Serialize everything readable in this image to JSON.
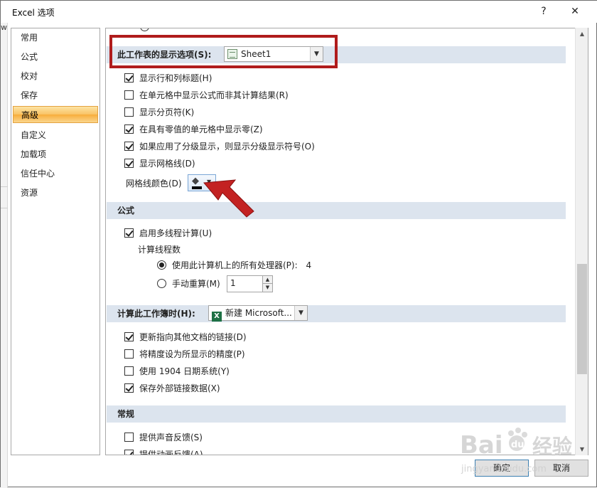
{
  "window": {
    "title": "Excel 选项",
    "help_label": "?",
    "close_label": "✕"
  },
  "left_strip": {
    "fragment": "w"
  },
  "nav": {
    "items": [
      {
        "label": "常用"
      },
      {
        "label": "公式"
      },
      {
        "label": "校对"
      },
      {
        "label": "保存"
      },
      {
        "label": "高级",
        "active": true
      },
      {
        "label": "自定义"
      },
      {
        "label": "加载项"
      },
      {
        "label": "信任中心"
      },
      {
        "label": "资源"
      }
    ]
  },
  "content": {
    "worksheet_section": {
      "header_label": "此工作表的显示选项(S):",
      "dropdown_value": "Sheet1",
      "options": [
        {
          "label": "显示行和列标题(H)",
          "checked": true
        },
        {
          "label": "在单元格中显示公式而非其计算结果(R)",
          "checked": false
        },
        {
          "label": "显示分页符(K)",
          "checked": false
        },
        {
          "label": "在具有零值的单元格中显示零(Z)",
          "checked": true
        },
        {
          "label": "如果应用了分级显示，则显示分级显示符号(O)",
          "checked": true
        },
        {
          "label": "显示网格线(D)",
          "checked": true
        }
      ],
      "gridline_color_label": "网格线颜色(D)"
    },
    "formula_section": {
      "header_label": "公式",
      "multithread_label": "启用多线程计算(U)",
      "multithread_checked": true,
      "thread_count_label": "计算线程数",
      "use_all_label": "使用此计算机上的所有处理器(P):",
      "processor_count": "4",
      "manual_label": "手动重算(M)",
      "manual_value": "1"
    },
    "workbook_section": {
      "header_label": "计算此工作簿时(H):",
      "dropdown_value": "新建 Microsoft...",
      "options": [
        {
          "label": "更新指向其他文档的链接(D)",
          "checked": true
        },
        {
          "label": "将精度设为所显示的精度(P)",
          "checked": false
        },
        {
          "label": "使用 1904 日期系统(Y)",
          "checked": false
        },
        {
          "label": "保存外部链接数据(X)",
          "checked": true
        }
      ]
    },
    "general_section": {
      "header_label": "常规",
      "options": [
        {
          "label": "提供声音反馈(S)",
          "checked": false
        },
        {
          "label": "提供动画反馈(A)",
          "checked": true
        }
      ]
    }
  },
  "footer": {
    "ok_label": "确定",
    "cancel_label": "取消"
  },
  "watermark": {
    "brand": "Bai",
    "brand2": "du",
    "suffix": "经验",
    "url": "jingyan.baidu.com"
  },
  "colors": {
    "highlight": "#b01c1c",
    "section_bg": "#dce4ee",
    "nav_active": "#f9c264"
  }
}
